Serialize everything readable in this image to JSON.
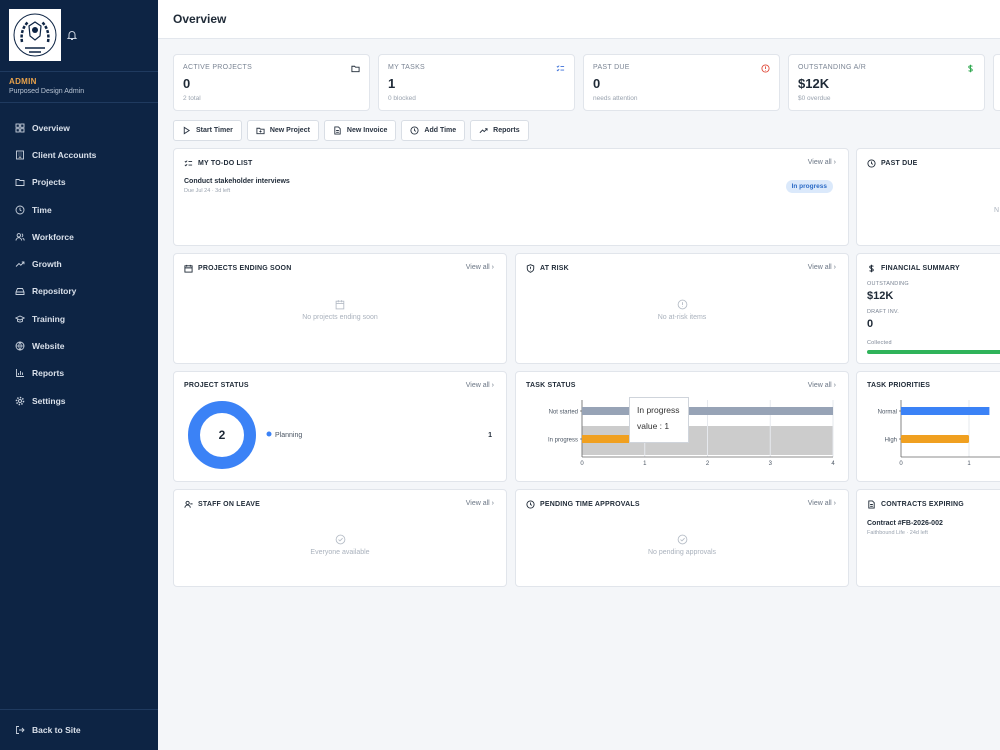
{
  "sidebar": {
    "role": "ADMIN",
    "role_sub": "Purposed Design Admin",
    "nav": [
      {
        "label": "Overview",
        "icon": "grid-icon"
      },
      {
        "label": "Client Accounts",
        "icon": "building-icon"
      },
      {
        "label": "Projects",
        "icon": "folder-icon"
      },
      {
        "label": "Time",
        "icon": "clock-icon"
      },
      {
        "label": "Workforce",
        "icon": "users-icon"
      },
      {
        "label": "Growth",
        "icon": "trending-up-icon"
      },
      {
        "label": "Repository",
        "icon": "drive-icon"
      },
      {
        "label": "Training",
        "icon": "graduation-cap-icon"
      },
      {
        "label": "Website",
        "icon": "globe-icon"
      },
      {
        "label": "Reports",
        "icon": "bar-chart-icon"
      },
      {
        "label": "Settings",
        "icon": "gear-icon"
      }
    ],
    "back": "Back to Site"
  },
  "header": {
    "title": "Overview"
  },
  "stats": [
    {
      "label": "ACTIVE PROJECTS",
      "value": "0",
      "sub": "2 total",
      "icon": "folder-icon",
      "color": "#1f2a37"
    },
    {
      "label": "MY TASKS",
      "value": "1",
      "sub": "0 blocked",
      "icon": "list-check-icon",
      "color": "#3b6fd8"
    },
    {
      "label": "PAST DUE",
      "value": "0",
      "sub": "needs attention",
      "icon": "alert-circle-icon",
      "color": "#e04a3a"
    },
    {
      "label": "OUTSTANDING A/R",
      "value": "$12K",
      "sub": "$0 overdue",
      "icon": "dollar-icon",
      "color": "#2fa84f"
    }
  ],
  "actions": [
    "Start Timer",
    "New Project",
    "New Invoice",
    "Add Time",
    "Reports"
  ],
  "view_all": "View all",
  "todo": {
    "title": "MY TO-DO LIST",
    "item": "Conduct stakeholder interviews",
    "due": "Due Jul 24 · 3d left",
    "status": "In progress"
  },
  "past_due": {
    "title": "PAST DUE",
    "partial": "N"
  },
  "ending": {
    "title": "PROJECTS ENDING SOON",
    "empty": "No projects ending soon"
  },
  "at_risk": {
    "title": "AT RISK",
    "empty": "No at-risk items"
  },
  "financial": {
    "title": "FINANCIAL SUMMARY",
    "outstanding_label": "OUTSTANDING",
    "outstanding_value": "$12K",
    "draft_label": "DRAFT INV.",
    "draft_value": "0",
    "collected_label": "Collected",
    "collected_fraction": 1.0,
    "bar_color": "#2fb35a"
  },
  "project_status": {
    "title": "PROJECT STATUS",
    "center": "2",
    "legend": "Planning",
    "count": "1",
    "color": "#3b82f6"
  },
  "task_status": {
    "title": "TASK STATUS",
    "tooltip_label": "In progress",
    "tooltip_value": "value : 1"
  },
  "task_priorities": {
    "title": "TASK PRIORITIES"
  },
  "staff_leave": {
    "title": "STAFF ON LEAVE",
    "empty": "Everyone available"
  },
  "time_approvals": {
    "title": "PENDING TIME APPROVALS",
    "empty": "No pending approvals"
  },
  "contracts": {
    "title": "CONTRACTS EXPIRING",
    "item": "Contract #FB-2026-002",
    "sub": "Faithbound Life · 24d left"
  },
  "chart_data": [
    {
      "type": "bar",
      "orientation": "horizontal",
      "title": "TASK STATUS",
      "categories": [
        "Not started",
        "In progress"
      ],
      "values": [
        4,
        1
      ],
      "colors": [
        "#97a3b6",
        "#f0a020"
      ],
      "xlim": [
        0,
        4
      ],
      "xticks": [
        "0",
        "1",
        "2",
        "3",
        "4"
      ]
    },
    {
      "type": "bar",
      "orientation": "horizontal",
      "title": "TASK PRIORITIES",
      "categories": [
        "Normal",
        "High"
      ],
      "values": [
        1.3,
        1
      ],
      "colors": [
        "#3b82f6",
        "#f0a020"
      ],
      "xticks": [
        "0",
        "1"
      ]
    }
  ]
}
